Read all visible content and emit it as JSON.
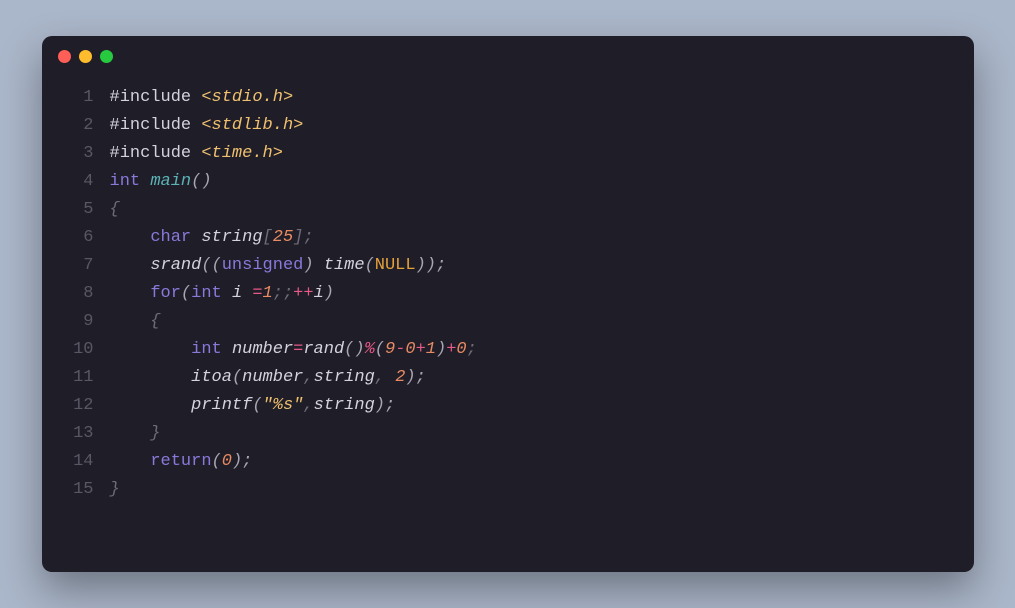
{
  "window": {
    "buttons": [
      "close",
      "minimize",
      "zoom"
    ]
  },
  "code": {
    "lines": [
      {
        "num": "1",
        "tokens": [
          {
            "t": "#include ",
            "c": "tk-pp"
          },
          {
            "t": "<stdio.h>",
            "c": "tk-str"
          }
        ]
      },
      {
        "num": "2",
        "tokens": [
          {
            "t": "#include ",
            "c": "tk-pp"
          },
          {
            "t": "<stdlib.h>",
            "c": "tk-str"
          }
        ]
      },
      {
        "num": "3",
        "tokens": [
          {
            "t": "#include ",
            "c": "tk-pp"
          },
          {
            "t": "<time.h>",
            "c": "tk-str"
          }
        ]
      },
      {
        "num": "4",
        "tokens": [
          {
            "t": "int",
            "c": "tk-type"
          },
          {
            "t": " ",
            "c": ""
          },
          {
            "t": "main",
            "c": "tk-fn"
          },
          {
            "t": "()",
            "c": "tk-paren"
          }
        ]
      },
      {
        "num": "5",
        "tokens": [
          {
            "t": "{",
            "c": "tk-punc"
          }
        ]
      },
      {
        "num": "6",
        "tokens": [
          {
            "t": "    ",
            "c": ""
          },
          {
            "t": "char",
            "c": "tk-type"
          },
          {
            "t": " ",
            "c": ""
          },
          {
            "t": "string",
            "c": "tk-ident"
          },
          {
            "t": "[",
            "c": "tk-punc"
          },
          {
            "t": "25",
            "c": "tk-num"
          },
          {
            "t": "];",
            "c": "tk-punc"
          }
        ]
      },
      {
        "num": "7",
        "tokens": [
          {
            "t": "    ",
            "c": ""
          },
          {
            "t": "srand",
            "c": "tk-ident"
          },
          {
            "t": "((",
            "c": "tk-paren"
          },
          {
            "t": "unsigned",
            "c": "tk-type"
          },
          {
            "t": ") ",
            "c": "tk-paren"
          },
          {
            "t": "time",
            "c": "tk-ident"
          },
          {
            "t": "(",
            "c": "tk-paren"
          },
          {
            "t": "NULL",
            "c": "tk-const"
          },
          {
            "t": "));",
            "c": "tk-paren"
          }
        ]
      },
      {
        "num": "8",
        "tokens": [
          {
            "t": "    ",
            "c": ""
          },
          {
            "t": "for",
            "c": "tk-kw"
          },
          {
            "t": "(",
            "c": "tk-paren"
          },
          {
            "t": "int",
            "c": "tk-type"
          },
          {
            "t": " ",
            "c": ""
          },
          {
            "t": "i",
            "c": "tk-ident"
          },
          {
            "t": " ",
            "c": ""
          },
          {
            "t": "=",
            "c": "tk-op"
          },
          {
            "t": "1",
            "c": "tk-num"
          },
          {
            "t": ";;",
            "c": "tk-punc"
          },
          {
            "t": "++",
            "c": "tk-op"
          },
          {
            "t": "i",
            "c": "tk-ident"
          },
          {
            "t": ")",
            "c": "tk-paren"
          }
        ]
      },
      {
        "num": "9",
        "tokens": [
          {
            "t": "    {",
            "c": "tk-punc"
          }
        ]
      },
      {
        "num": "10",
        "tokens": [
          {
            "t": "        ",
            "c": ""
          },
          {
            "t": "int",
            "c": "tk-type"
          },
          {
            "t": " ",
            "c": ""
          },
          {
            "t": "number",
            "c": "tk-ident"
          },
          {
            "t": "=",
            "c": "tk-op"
          },
          {
            "t": "rand",
            "c": "tk-ident"
          },
          {
            "t": "()",
            "c": "tk-paren"
          },
          {
            "t": "%",
            "c": "tk-op"
          },
          {
            "t": "(",
            "c": "tk-paren"
          },
          {
            "t": "9",
            "c": "tk-num"
          },
          {
            "t": "-",
            "c": "tk-op"
          },
          {
            "t": "0",
            "c": "tk-num"
          },
          {
            "t": "+",
            "c": "tk-op"
          },
          {
            "t": "1",
            "c": "tk-num"
          },
          {
            "t": ")",
            "c": "tk-paren"
          },
          {
            "t": "+",
            "c": "tk-op"
          },
          {
            "t": "0",
            "c": "tk-num"
          },
          {
            "t": ";",
            "c": "tk-punc"
          }
        ]
      },
      {
        "num": "11",
        "tokens": [
          {
            "t": "        ",
            "c": ""
          },
          {
            "t": "itoa",
            "c": "tk-ident"
          },
          {
            "t": "(",
            "c": "tk-paren"
          },
          {
            "t": "number",
            "c": "tk-ident"
          },
          {
            "t": ",",
            "c": "tk-punc"
          },
          {
            "t": "string",
            "c": "tk-ident"
          },
          {
            "t": ", ",
            "c": "tk-punc"
          },
          {
            "t": "2",
            "c": "tk-num"
          },
          {
            "t": ");",
            "c": "tk-paren"
          }
        ]
      },
      {
        "num": "12",
        "tokens": [
          {
            "t": "        ",
            "c": ""
          },
          {
            "t": "printf",
            "c": "tk-ident"
          },
          {
            "t": "(",
            "c": "tk-paren"
          },
          {
            "t": "\"%s\"",
            "c": "tk-str"
          },
          {
            "t": ",",
            "c": "tk-punc"
          },
          {
            "t": "string",
            "c": "tk-ident"
          },
          {
            "t": ");",
            "c": "tk-paren"
          }
        ]
      },
      {
        "num": "13",
        "tokens": [
          {
            "t": "    }",
            "c": "tk-punc"
          }
        ]
      },
      {
        "num": "14",
        "tokens": [
          {
            "t": "    ",
            "c": ""
          },
          {
            "t": "return",
            "c": "tk-kw"
          },
          {
            "t": "(",
            "c": "tk-paren"
          },
          {
            "t": "0",
            "c": "tk-num"
          },
          {
            "t": ");",
            "c": "tk-paren"
          }
        ]
      },
      {
        "num": "15",
        "tokens": [
          {
            "t": "}",
            "c": "tk-punc"
          }
        ]
      }
    ]
  }
}
